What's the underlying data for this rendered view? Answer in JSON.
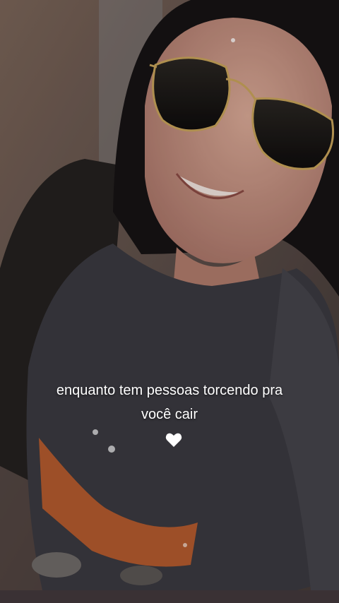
{
  "story": {
    "caption_line1": "enquanto tem pessoas torcendo pra",
    "caption_line2": "você cair",
    "emoji": "white-heart"
  },
  "colors": {
    "caption_text": "#ffffff",
    "shirt": "#3b3a40",
    "pants": "#b35a2e",
    "background": "#6a5a52"
  }
}
